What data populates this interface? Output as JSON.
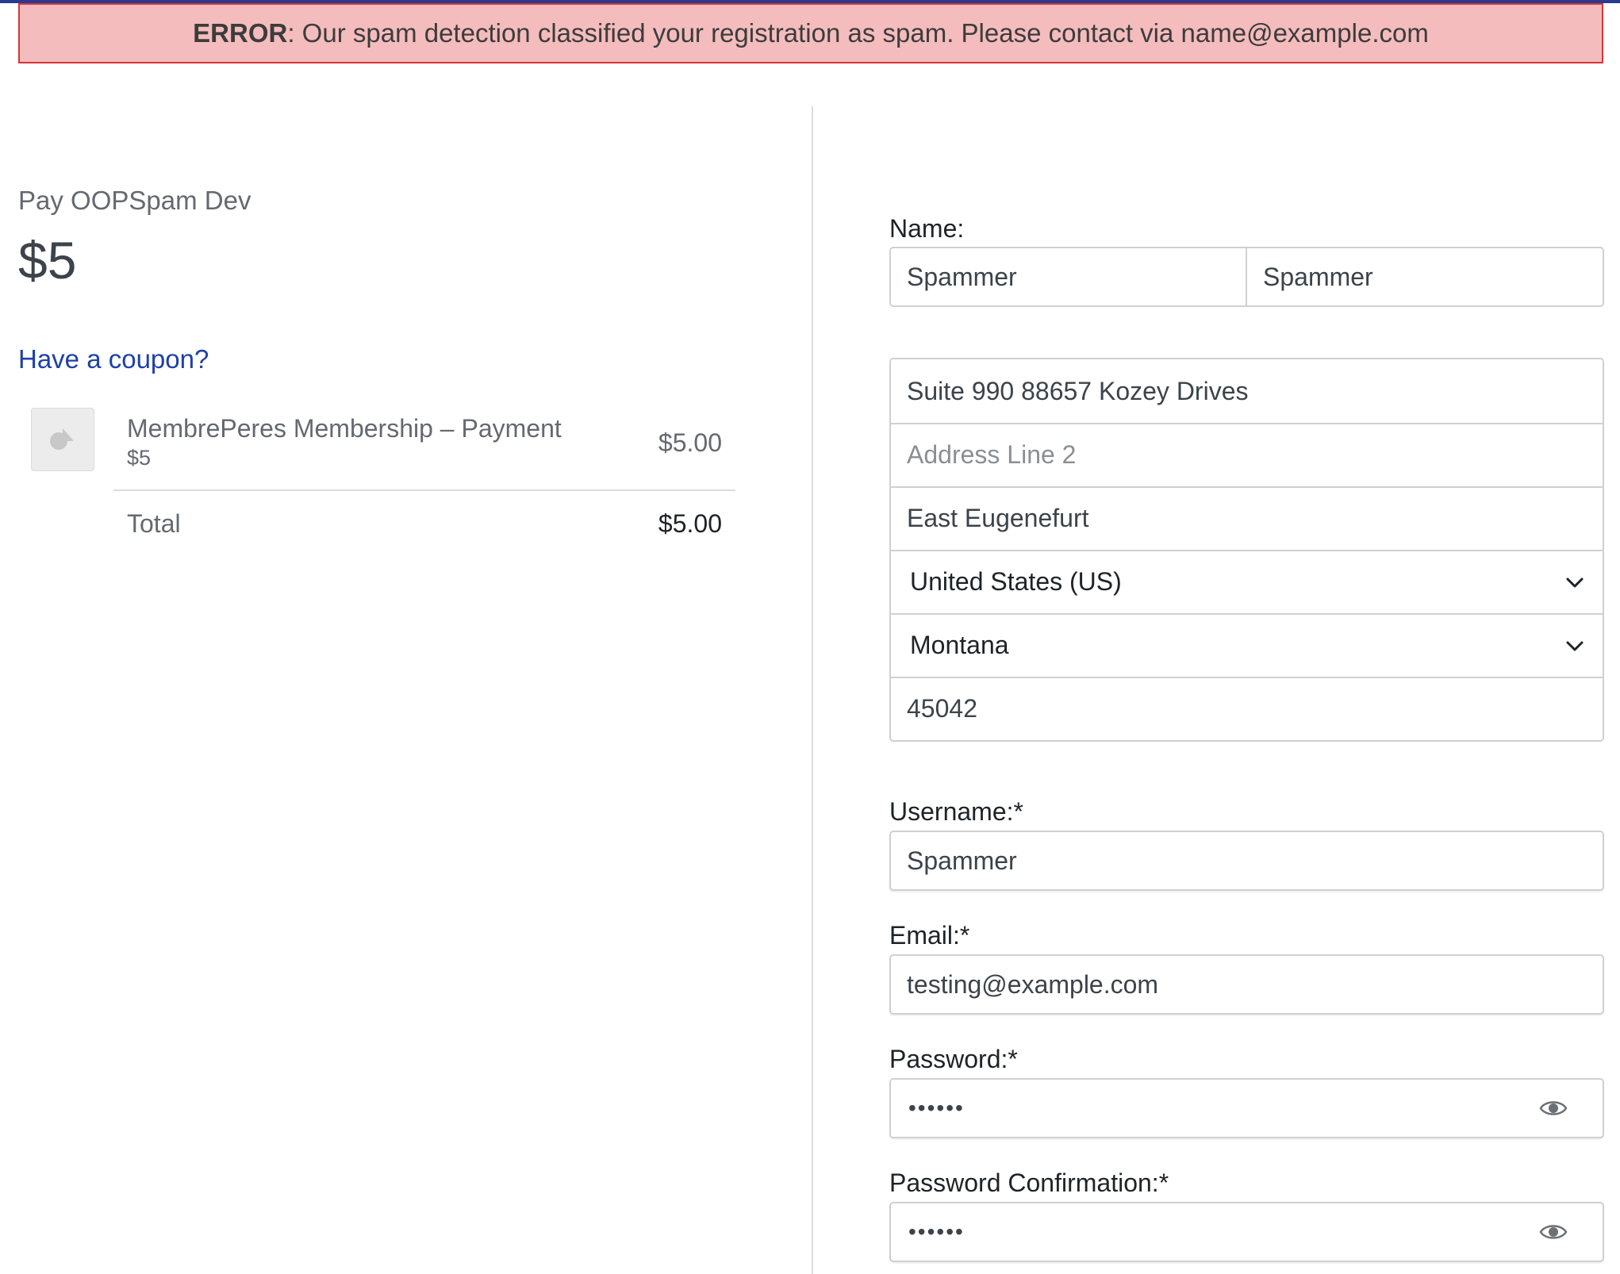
{
  "error": {
    "prefix": "ERROR",
    "message": ": Our spam detection classified your registration as spam. Please contact via name@example.com"
  },
  "summary": {
    "title": "Pay OOPSpam Dev",
    "amount": "$5",
    "coupon_link": "Have a coupon?",
    "item": {
      "name": "MembrePeres Membership – Payment",
      "sub": "$5",
      "price": "$5.00"
    },
    "total_label": "Total",
    "total_value": "$5.00"
  },
  "form": {
    "name_label": "Name:",
    "first_name": "Spammer",
    "last_name": "Spammer",
    "address": {
      "line1": "Suite 990 88657 Kozey Drives",
      "line2_placeholder": "Address Line 2",
      "city": "East Eugenefurt",
      "country": "United States (US)",
      "state": "Montana",
      "zip": "45042"
    },
    "username_label": "Username:*",
    "username": "Spammer",
    "email_label": "Email:*",
    "email": "testing@example.com",
    "password_label": "Password:*",
    "password_mask": "••••••",
    "password_confirm_label": "Password Confirmation:*",
    "password_confirm_mask": "••••••"
  },
  "icons": {
    "thumb": "image-placeholder-icon",
    "chevron": "chevron-down-icon",
    "eye": "eye-icon"
  }
}
